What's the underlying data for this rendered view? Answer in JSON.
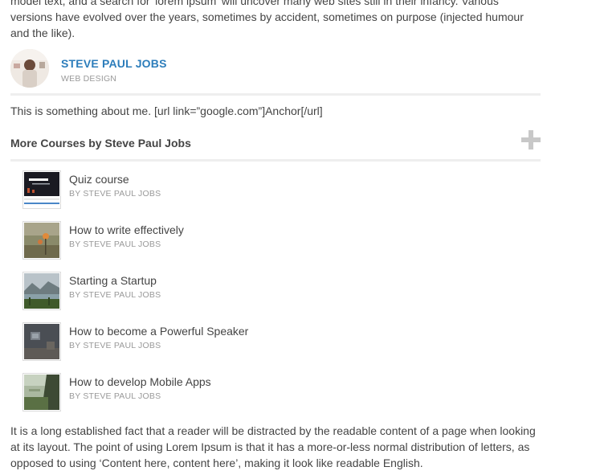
{
  "top_paragraph": "model text, and a search for 'lorem ipsum' will uncover many web sites still in their infancy. Various versions have evolved over the years, sometimes by accident, sometimes on purpose (injected humour and the like).",
  "author": {
    "name": "STEVE PAUL JOBS",
    "role": "WEB DESIGN"
  },
  "about": "This is something about me. [url link=”google.com”]Anchor[/url]",
  "more_courses": {
    "title": "More Courses by Steve Paul Jobs",
    "items": [
      {
        "title": "Quiz course",
        "by": "BY STEVE PAUL JOBS"
      },
      {
        "title": "How to write effectively",
        "by": "BY STEVE PAUL JOBS"
      },
      {
        "title": "Starting a Startup",
        "by": "BY STEVE PAUL JOBS"
      },
      {
        "title": "How to become a Powerful Speaker",
        "by": "BY STEVE PAUL JOBS"
      },
      {
        "title": "How to develop Mobile Apps",
        "by": "BY STEVE PAUL JOBS"
      }
    ]
  },
  "bottom_paragraph": "It is a long established fact that a reader will be distracted by the readable content of a page when looking at its layout. The point of using Lorem Ipsum is that it has a more-or-less normal distribution of letters, as opposed to using ‘Content here, content here’, making it look like readable English.",
  "colors": {
    "link": "#2c7dbb",
    "muted": "#999999",
    "divider": "#eeeeee"
  }
}
